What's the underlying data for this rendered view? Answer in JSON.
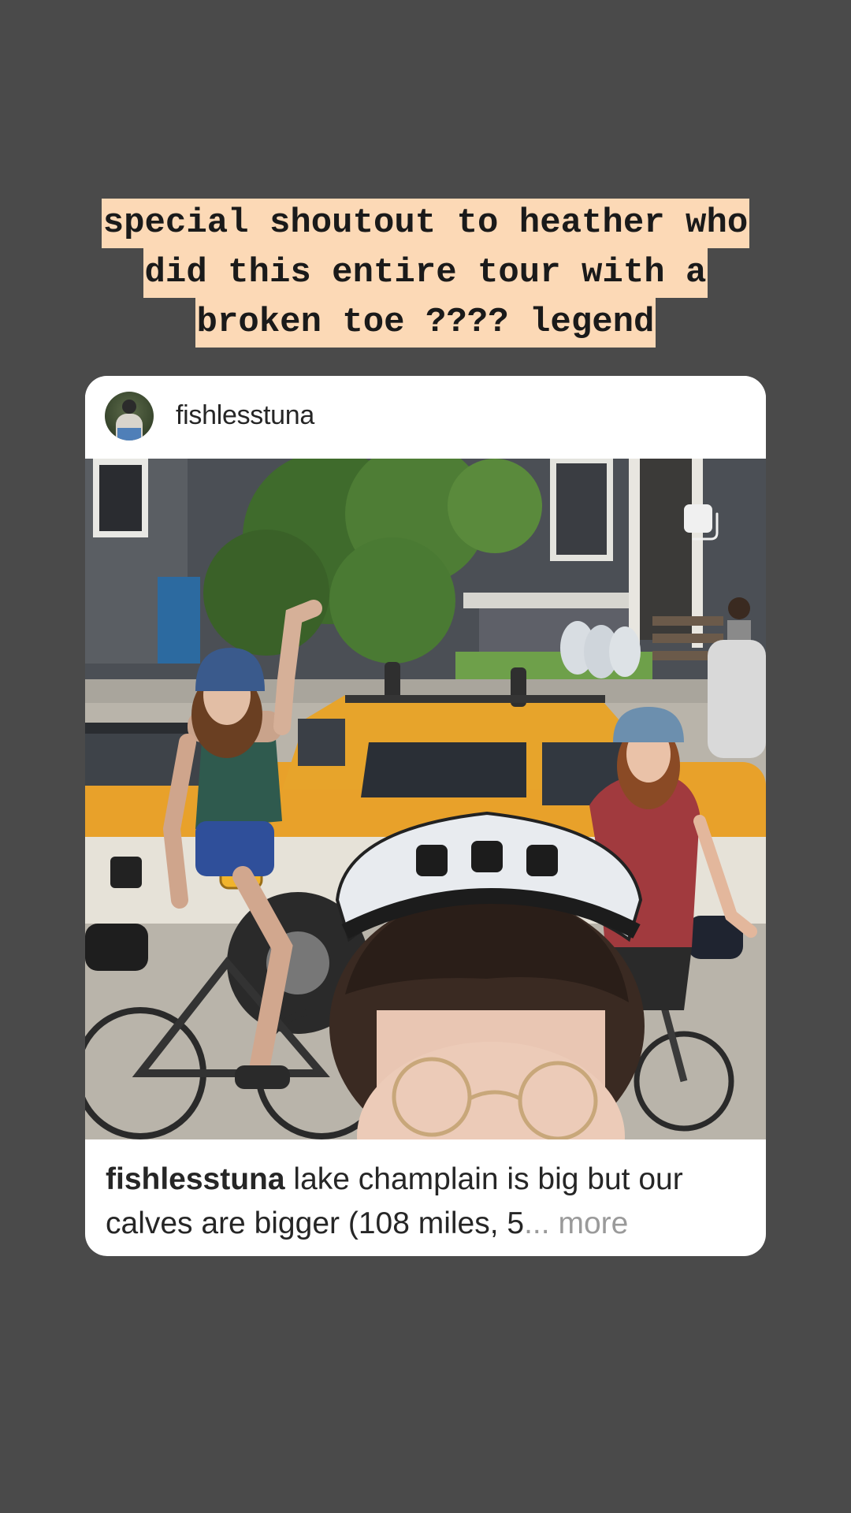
{
  "story": {
    "text_lines": [
      "special shoutout to heather who",
      "did this entire tour with a",
      "broken toe ???? legend"
    ]
  },
  "post": {
    "username": "fishlesstuna",
    "caption_username": "fishlesstuna",
    "caption_text": "lake champlain is big but our calves are bigger (108 miles, 5",
    "ellipsis": "...",
    "more_label": "more",
    "photo_icon": "multiple-photos-icon"
  },
  "colors": {
    "background": "#4a4a4a",
    "text_highlight": "#fcd9b6",
    "card": "#ffffff",
    "more_text": "#9a9a9a"
  }
}
